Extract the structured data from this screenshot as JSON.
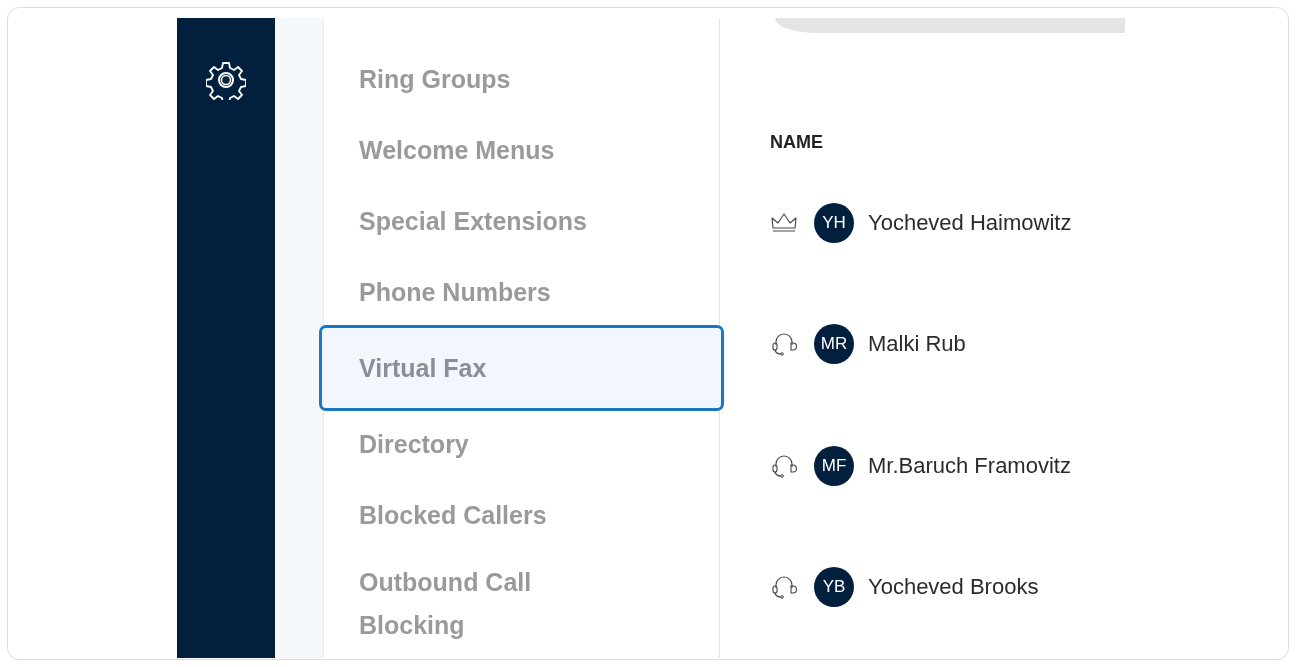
{
  "menu": [
    {
      "label": "Ring Groups",
      "selected": false
    },
    {
      "label": "Welcome Menus",
      "selected": false
    },
    {
      "label": "Special Extensions",
      "selected": false
    },
    {
      "label": "Phone Numbers",
      "selected": false
    },
    {
      "label": "Virtual Fax",
      "selected": true
    },
    {
      "label": "Directory",
      "selected": false
    },
    {
      "label": "Blocked Callers",
      "selected": false
    },
    {
      "label": "Outbound Call Blocking",
      "selected": false
    }
  ],
  "table": {
    "columns": [
      "NAME"
    ],
    "rows": [
      {
        "kind": "owner",
        "initials": "YH",
        "name": "Yocheved Haimowitz"
      },
      {
        "kind": "agent",
        "initials": "MR",
        "name": "Malki Rub"
      },
      {
        "kind": "agent",
        "initials": "MF",
        "name": "Mr.Baruch Framovitz"
      },
      {
        "kind": "agent",
        "initials": "YB",
        "name": "Yocheved Brooks"
      }
    ]
  }
}
